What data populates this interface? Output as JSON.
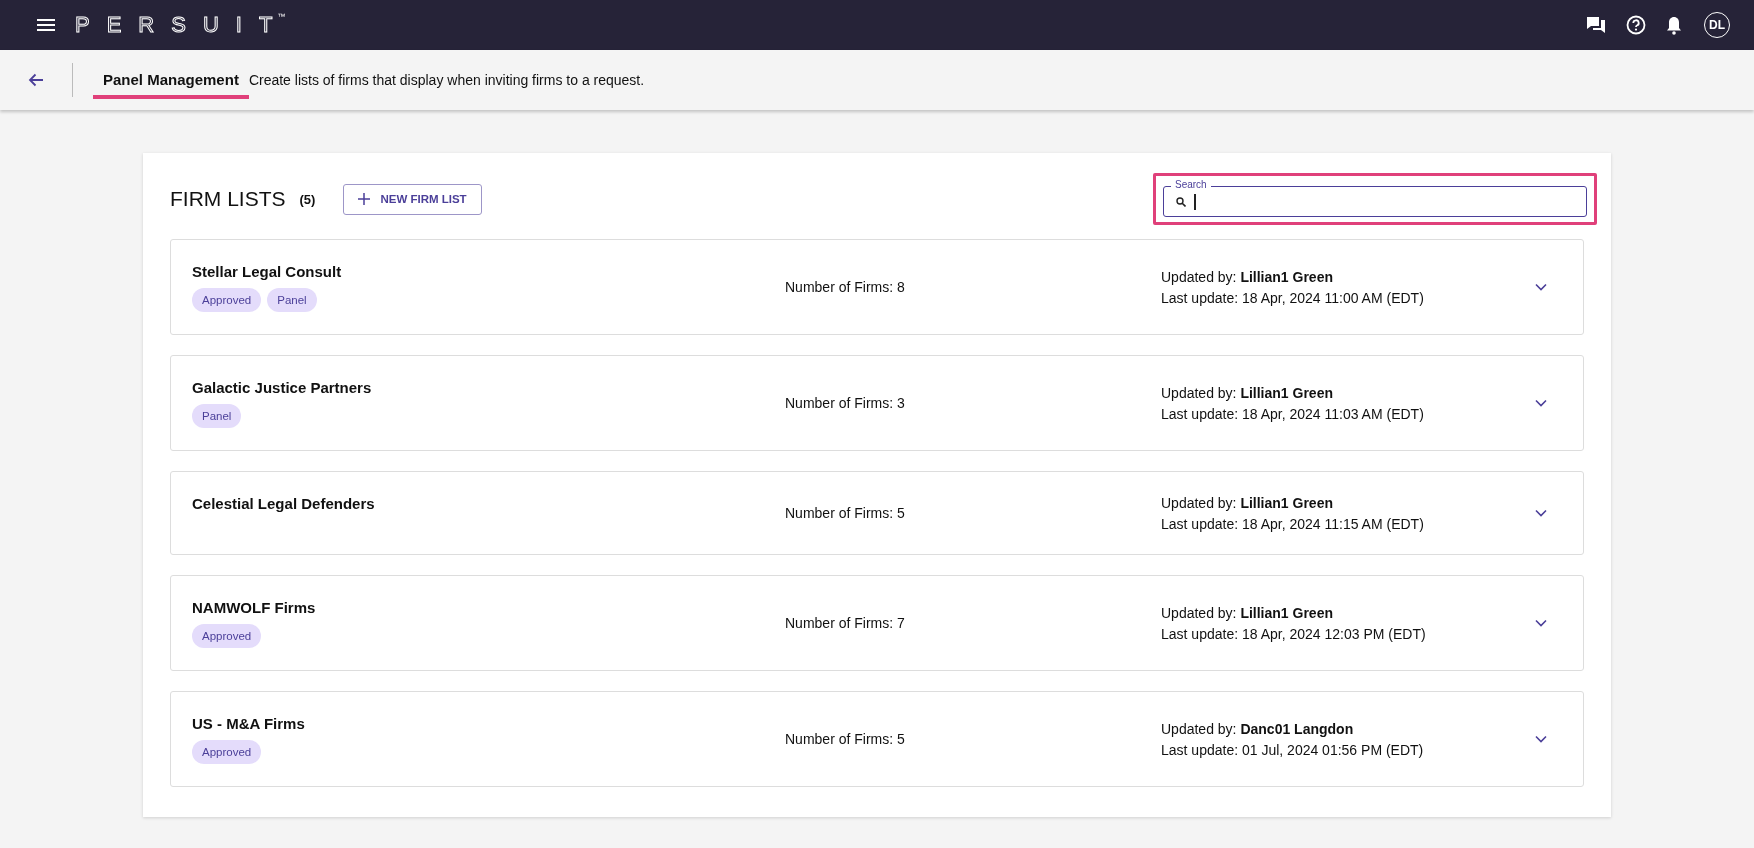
{
  "top_bar": {
    "logo": "PERSUIT",
    "trademark": "™",
    "avatar": "DL"
  },
  "header": {
    "title": "Panel Management",
    "title_highlighted": true,
    "description": "Create lists of firms that display when inviting firms to a request."
  },
  "firm_lists": {
    "title": "FIRM LISTS",
    "count": "(5)",
    "new_button": "NEW FIRM LIST",
    "search": {
      "label": "Search",
      "highlighted": true
    },
    "items": [
      {
        "name": "Stellar Legal Consult",
        "tags": [
          "Approved",
          "Panel"
        ],
        "firms": "Number of Firms: 8",
        "updated_by": "Updated by: **Lillian1 Green**",
        "last_update": "Last update: 18 Apr, 2024 11:00 AM (EDT)",
        "expanded": false
      },
      {
        "name": "Galactic Justice Partners",
        "tags": [
          "Panel"
        ],
        "firms": "Number of Firms: 3",
        "updated_by": "Updated by: **Lillian1 Green**",
        "last_update": "Last update: 18 Apr, 2024 11:03 AM (EDT)",
        "expanded": false
      },
      {
        "name": "Celestial Legal Defenders",
        "firms": "Number of Firms: 5",
        "updated_by": "Updated by: **Lillian1 Green**",
        "last_update": "Last update: 18 Apr, 2024 11:15 AM (EDT)",
        "expanded": false
      },
      {
        "name": "NAMWOLF Firms",
        "tags": [
          "Approved"
        ],
        "firms": "Number of Firms: 7",
        "updated_by": "Updated by: **Lillian1 Green**",
        "last_update": "Last update: 18 Apr, 2024 12:03 PM (EDT)",
        "expanded": false
      },
      {
        "name": "US - M&A Firms",
        "tags": [
          "Approved"
        ],
        "firms": "Number of Firms: 5",
        "updated_by": "Updated by: **Danc01 Langdon**",
        "last_update": "Last update: 01 Jul, 2024 01:56 PM (EDT)",
        "expanded": false
      }
    ]
  }
}
